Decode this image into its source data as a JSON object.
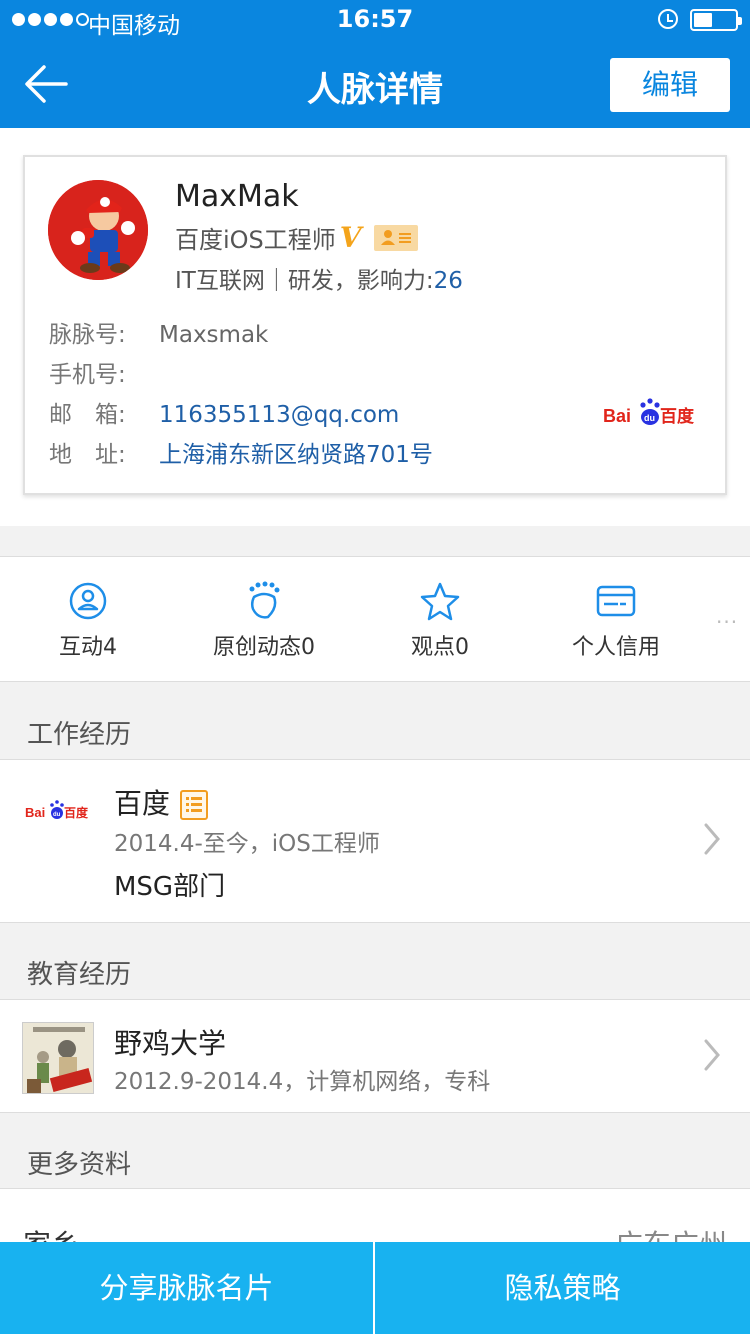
{
  "status_bar": {
    "carrier": "中国移动",
    "time": "16:57"
  },
  "nav": {
    "title": "人脉详情",
    "edit_label": "编辑"
  },
  "profile": {
    "name": "MaxMak",
    "title": "百度iOS工程师",
    "v_badge": "V",
    "industry_prefix": "IT互联网｜研发，影响力:",
    "influence": "26",
    "fields": [
      {
        "label": "脉脉号:",
        "value": "Maxsmak"
      },
      {
        "label": "手机号:",
        "value": ""
      },
      {
        "label": "邮　箱:",
        "value": "116355113@qq.com"
      },
      {
        "label": "地　址:",
        "value": "上海浦东新区纳贤路701号"
      }
    ],
    "company_logo_text": "Bai百度"
  },
  "tabs": [
    {
      "label": "互动4",
      "icon": "user-circle-icon"
    },
    {
      "label": "原创动态0",
      "icon": "footprint-icon"
    },
    {
      "label": "观点0",
      "icon": "star-icon"
    },
    {
      "label": "个人信用",
      "icon": "credit-card-icon"
    }
  ],
  "more_dots": "···",
  "work": {
    "heading": "工作经历",
    "company": "百度",
    "period": "2014.4-至今，iOS工程师",
    "department": "MSG部门"
  },
  "education": {
    "heading": "教育经历",
    "school": "野鸡大学",
    "detail": "2012.9-2014.4，计算机网络，专科"
  },
  "more_info": {
    "heading": "更多资料",
    "label": "家乡",
    "value": "广东广州"
  },
  "bottom_bar": {
    "share_label": "分享脉脉名片",
    "privacy_label": "隐私策略"
  },
  "colors": {
    "nav_blue": "#0a86df",
    "bottom_blue": "#18b2f0",
    "link_blue": "#1f5fa7",
    "accent_orange": "#f4a41b",
    "baidu_red": "#e1251b",
    "baidu_blue": "#2932e1"
  }
}
